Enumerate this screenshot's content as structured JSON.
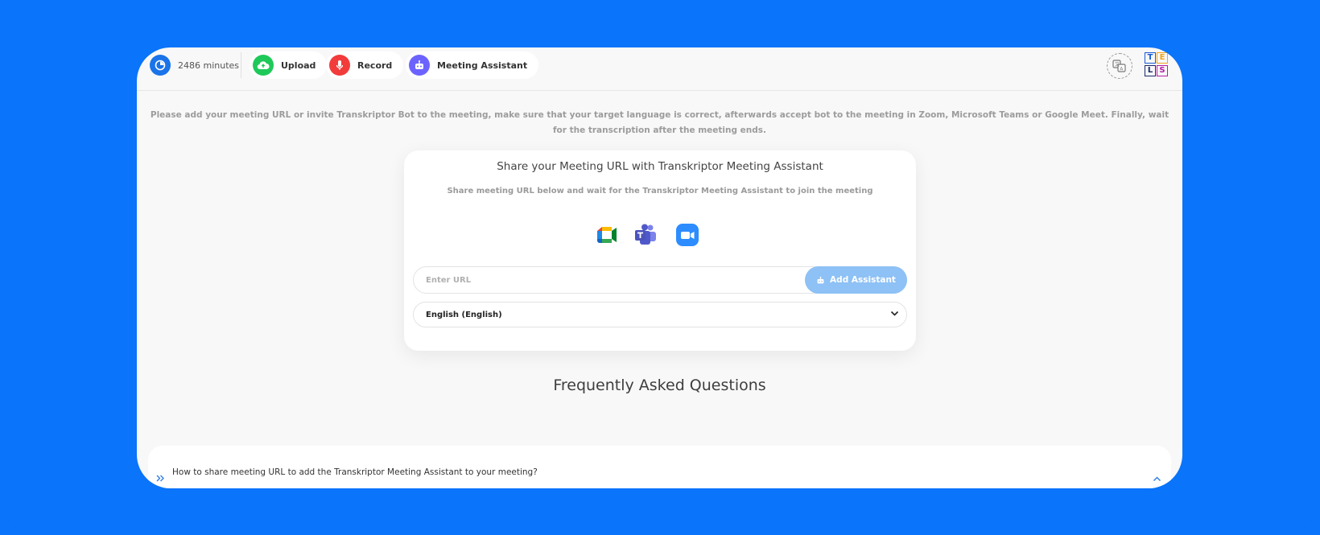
{
  "topbar": {
    "minutes_label": "2486 minutes",
    "upload_label": "Upload",
    "record_label": "Record",
    "assistant_label": "Meeting Assistant",
    "tls_letters": [
      "T",
      "E",
      "L",
      "S"
    ]
  },
  "instructions": "Please add your meeting URL or invite Transkriptor Bot to the meeting, make sure that your target language is correct, afterwards accept bot to the meeting in Zoom, Microsoft Teams or Google Meet. Finally, wait for the transcription after the meeting ends.",
  "card": {
    "title": "Share your Meeting URL with Transkriptor Meeting Assistant",
    "subtitle": "Share meeting URL below and wait for the Transkriptor Meeting Assistant to join the meeting",
    "platforms": [
      "google-meet-icon",
      "microsoft-teams-icon",
      "zoom-icon"
    ],
    "url_placeholder": "Enter URL",
    "add_button_label": "Add Assistant",
    "language_selected": "English (English)"
  },
  "faq": {
    "title": "Frequently Asked Questions",
    "question": "How to share meeting URL to add the Transkriptor Meeting Assistant to your meeting?"
  },
  "colors": {
    "background": "#0a74fa",
    "minutes_icon": "#1a73e8",
    "upload_icon": "#1ec95a",
    "record_icon": "#f23b3b",
    "assistant_icon": "#6c63ff",
    "add_button": "#8ec1f5"
  }
}
